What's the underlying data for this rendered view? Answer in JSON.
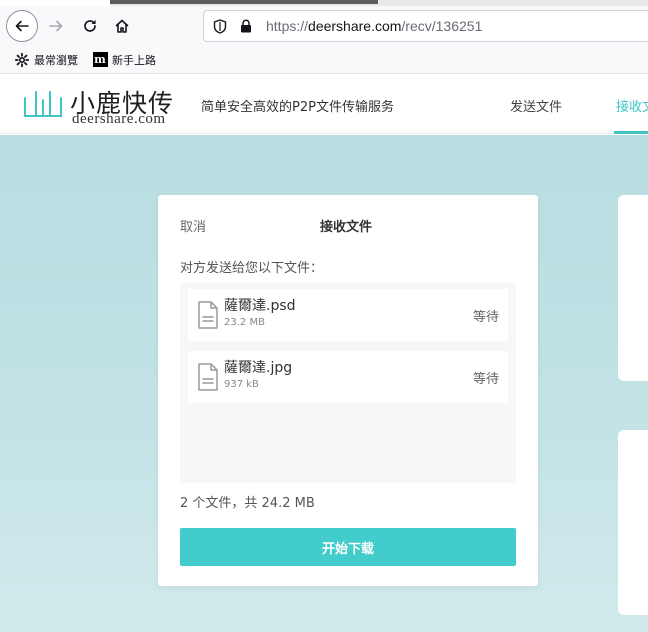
{
  "browser": {
    "url_prefix": "https://",
    "url_host": "deershare.com",
    "url_path": "/recv/136251",
    "bookmarks": [
      {
        "label": "最常瀏覽",
        "icon": "gear-icon"
      },
      {
        "label": "新手上路",
        "icon": "medium-icon",
        "icon_glyph": "m"
      }
    ]
  },
  "site": {
    "logo_cn": "小鹿快传",
    "logo_en": "deershare.com",
    "slogan": "简单安全高效的P2P文件传输服务",
    "nav": {
      "send": "发送文件",
      "receive": "接收文"
    },
    "accent_color": "#42cccc"
  },
  "card": {
    "cancel": "取消",
    "title": "接收文件",
    "intro": "对方发送给您以下文件：",
    "files": [
      {
        "name": "薩爾達.psd",
        "size": "23.2 MB",
        "status": "等待"
      },
      {
        "name": "薩爾達.jpg",
        "size": "937 kB",
        "status": "等待"
      }
    ],
    "summary": "2 个文件，共 24.2 MB",
    "download_label": "开始下载"
  }
}
